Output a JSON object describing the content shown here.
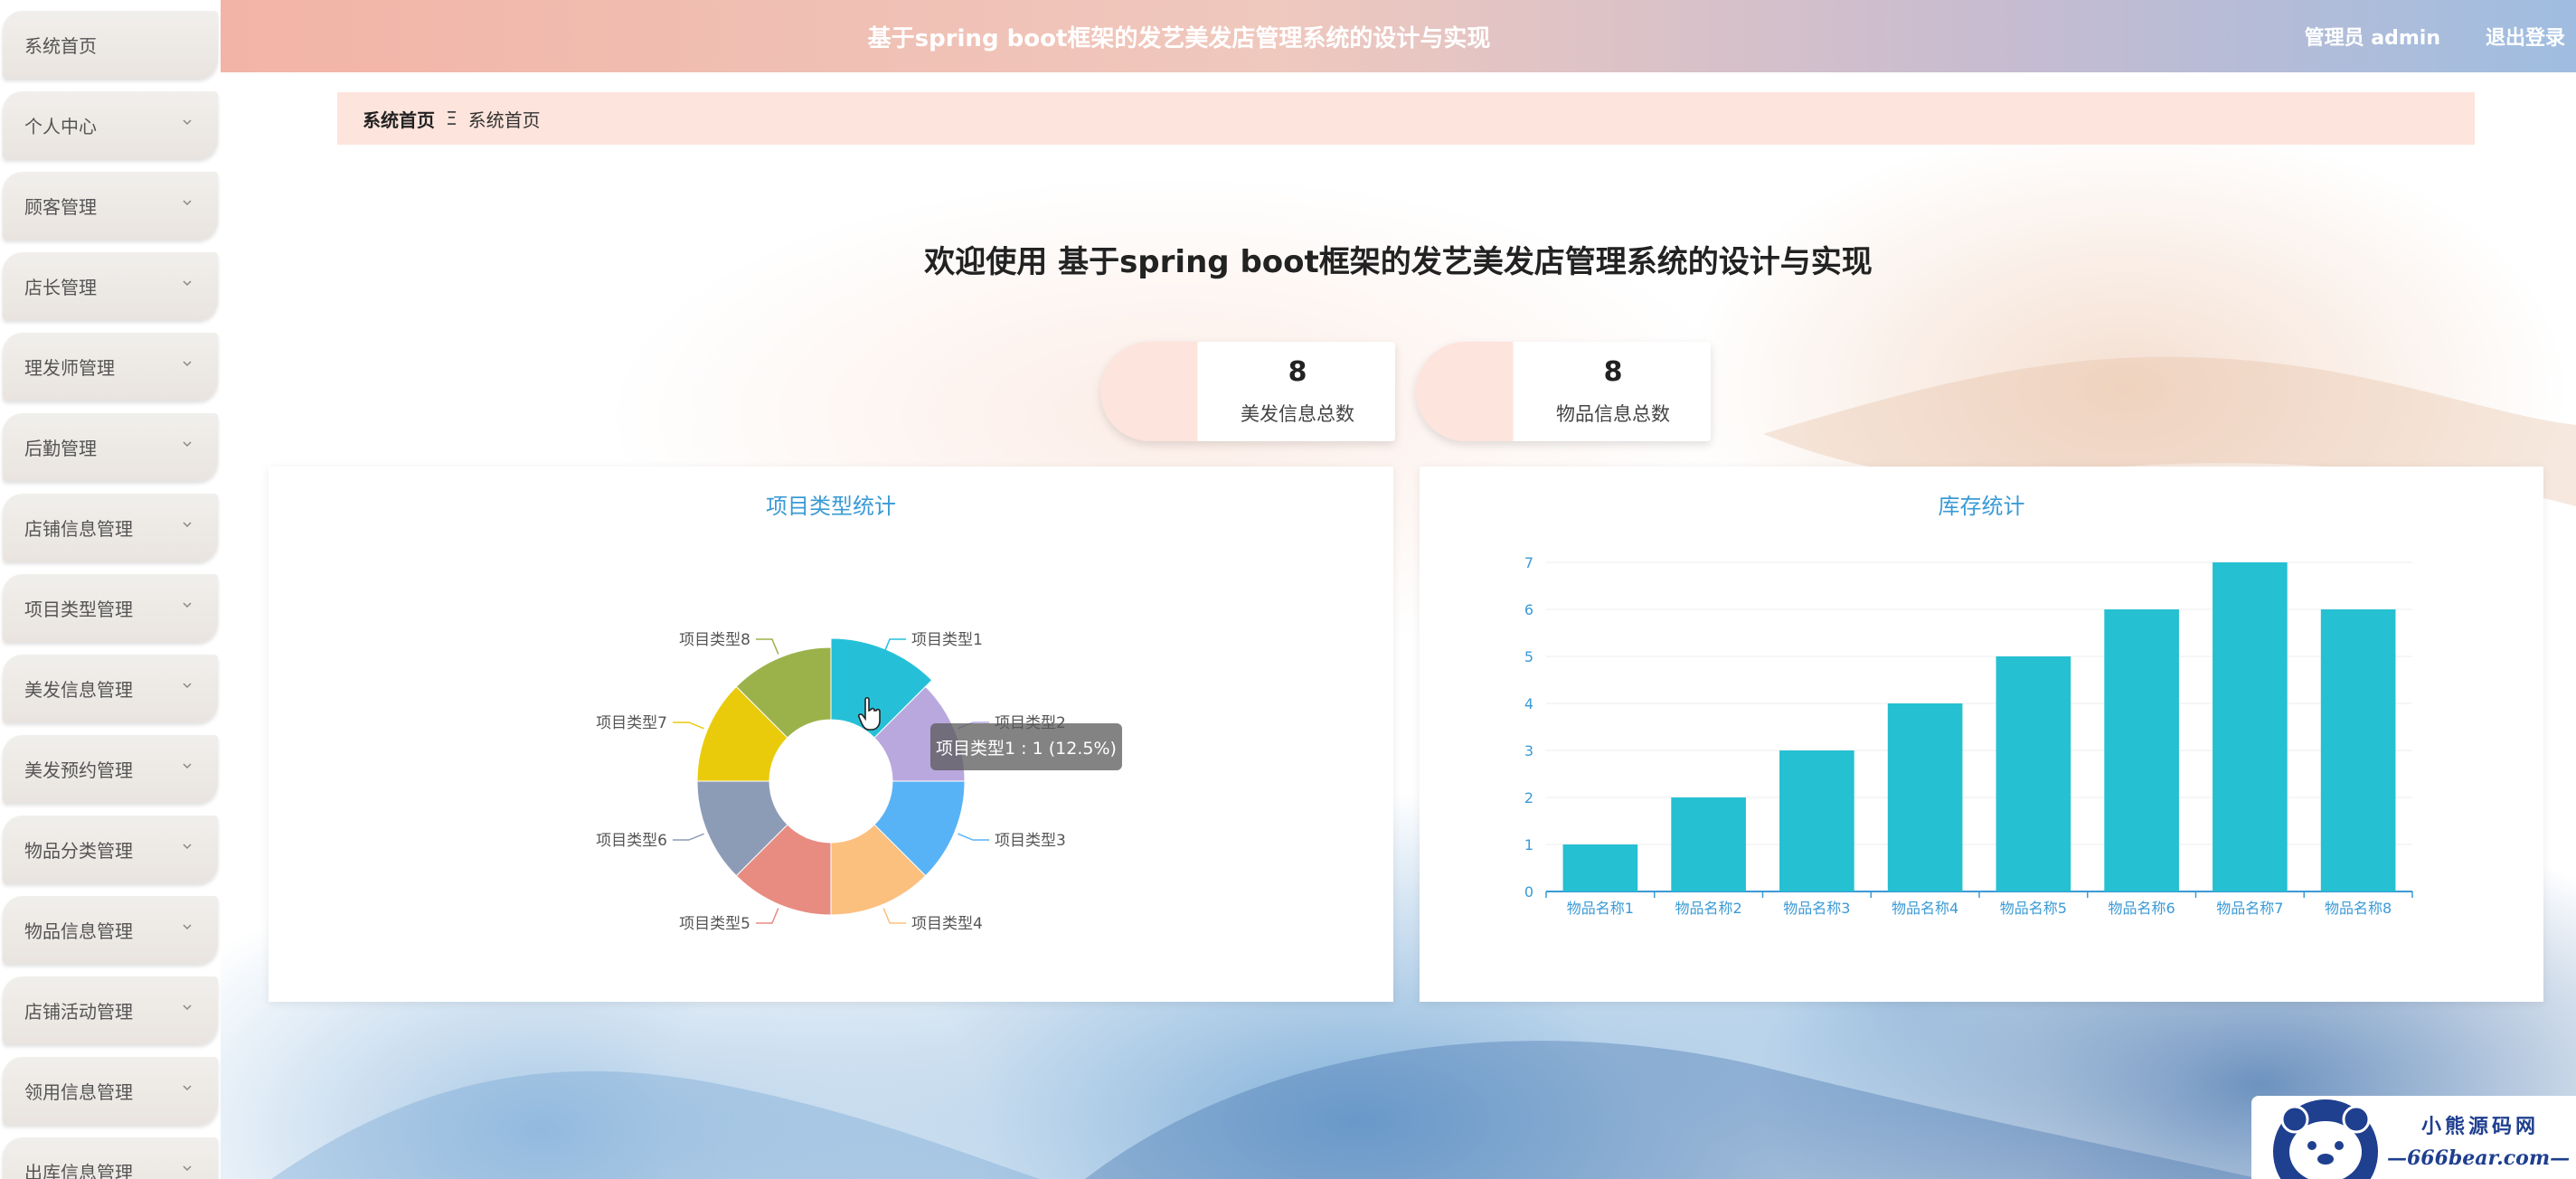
{
  "header": {
    "title": "基于spring boot框架的发艺美发店管理系统的设计与实现",
    "user": "管理员 admin",
    "logout": "退出登录"
  },
  "sidebar": {
    "items": [
      {
        "label": "系统首页",
        "has_submenu": false
      },
      {
        "label": "个人中心",
        "has_submenu": true
      },
      {
        "label": "顾客管理",
        "has_submenu": true
      },
      {
        "label": "店长管理",
        "has_submenu": true
      },
      {
        "label": "理发师管理",
        "has_submenu": true
      },
      {
        "label": "后勤管理",
        "has_submenu": true
      },
      {
        "label": "店铺信息管理",
        "has_submenu": true
      },
      {
        "label": "项目类型管理",
        "has_submenu": true
      },
      {
        "label": "美发信息管理",
        "has_submenu": true
      },
      {
        "label": "美发预约管理",
        "has_submenu": true
      },
      {
        "label": "物品分类管理",
        "has_submenu": true
      },
      {
        "label": "物品信息管理",
        "has_submenu": true
      },
      {
        "label": "店铺活动管理",
        "has_submenu": true
      },
      {
        "label": "领用信息管理",
        "has_submenu": true
      },
      {
        "label": "出库信息管理",
        "has_submenu": true
      }
    ]
  },
  "breadcrumb": {
    "home": "系统首页",
    "separator": "Ξ",
    "current": "系统首页"
  },
  "welcome": "欢迎使用 基于spring boot框架的发艺美发店管理系统的设计与实现",
  "stats": [
    {
      "value": "8",
      "label": "美发信息总数"
    },
    {
      "value": "8",
      "label": "物品信息总数"
    }
  ],
  "pie_panel": {
    "title": "项目类型统计"
  },
  "bar_panel": {
    "title": "库存统计"
  },
  "tooltip": "项目类型1 : 1 (12.5%)",
  "watermark": {
    "line1": "小熊源码网",
    "line2": "—666bear.com—"
  },
  "colors": {
    "accent": "#3a9ad6",
    "bar": "#25c0d1",
    "breadcrumb_bg": "#fde4dc"
  },
  "chart_data": [
    {
      "type": "pie",
      "title": "项目类型统计",
      "categories": [
        "项目类型1",
        "项目类型2",
        "项目类型3",
        "项目类型4",
        "项目类型5",
        "项目类型6",
        "项目类型7",
        "项目类型8"
      ],
      "values": [
        1,
        1,
        1,
        1,
        1,
        1,
        1,
        1
      ],
      "colors": [
        "#25c0d8",
        "#b9a8de",
        "#58b2f6",
        "#fbc07e",
        "#e88b80",
        "#8d9cb6",
        "#eacb0c",
        "#9bb24b"
      ],
      "donut": true,
      "highlighted": "项目类型1"
    },
    {
      "type": "bar",
      "title": "库存统计",
      "categories": [
        "物品名称1",
        "物品名称2",
        "物品名称3",
        "物品名称4",
        "物品名称5",
        "物品名称6",
        "物品名称7",
        "物品名称8"
      ],
      "values": [
        1,
        2,
        3,
        4,
        5,
        6,
        7,
        6
      ],
      "ylim": [
        0,
        7
      ],
      "yticks": [
        0,
        1,
        2,
        3,
        4,
        5,
        6,
        7
      ],
      "grid": true
    }
  ]
}
